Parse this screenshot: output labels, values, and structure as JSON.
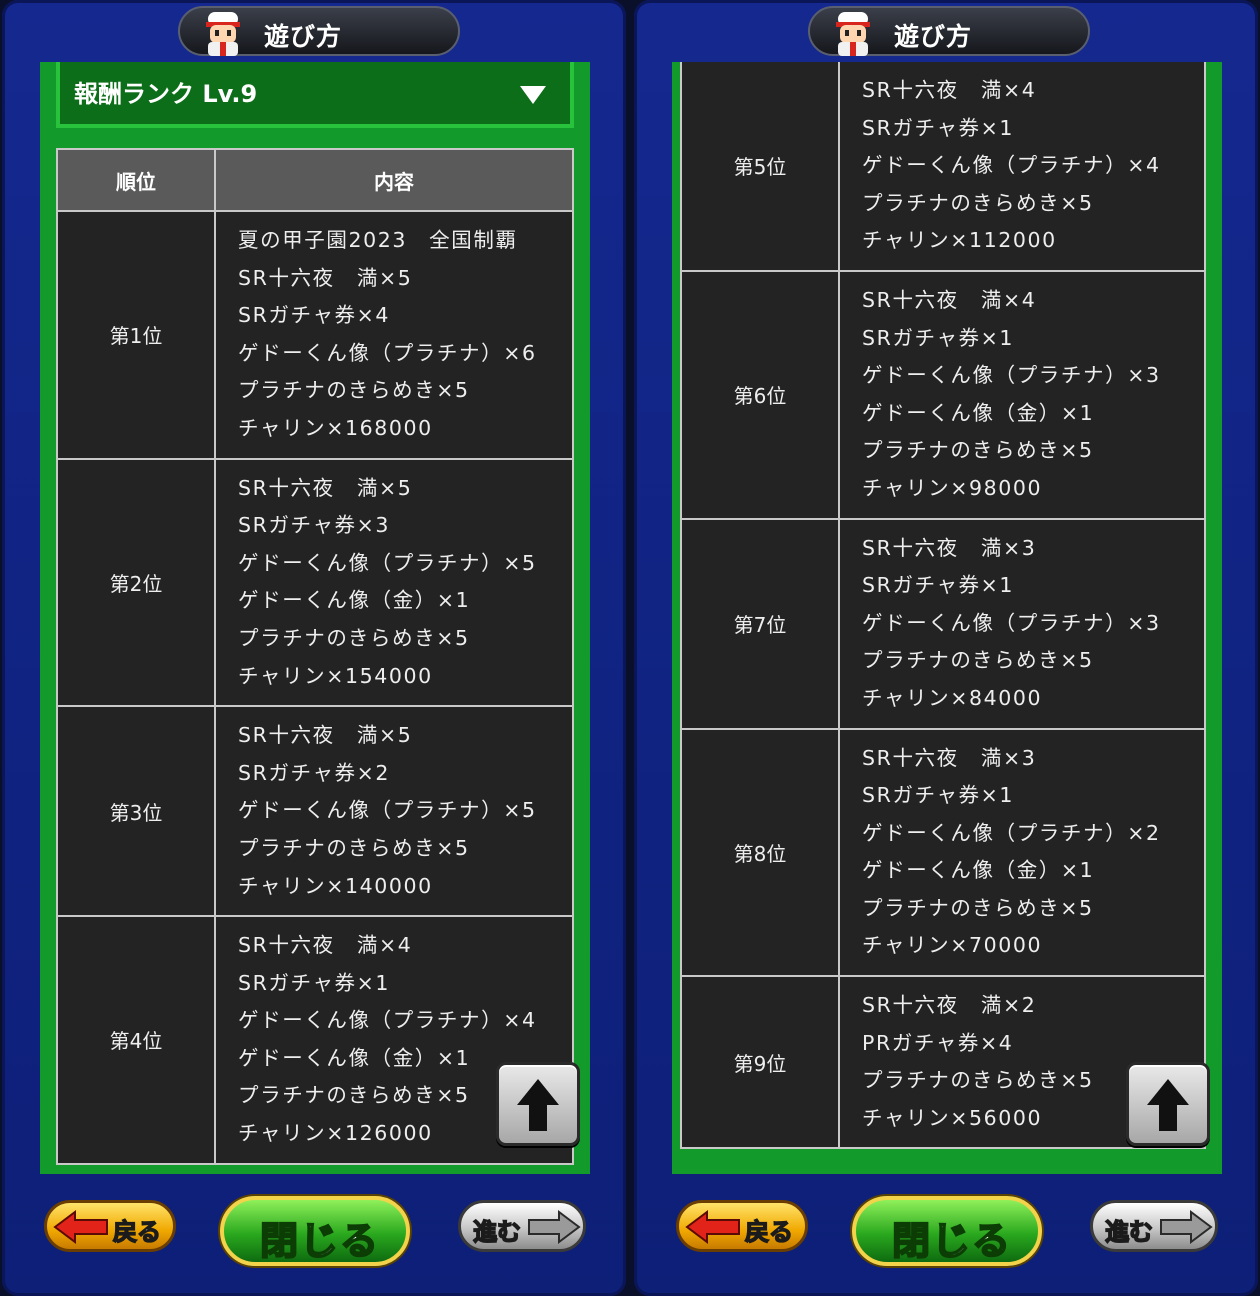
{
  "header": {
    "title": "遊び方"
  },
  "dropdown": {
    "label": "報酬ランク Lv.9"
  },
  "table": {
    "col_rank": "順位",
    "col_content": "内容"
  },
  "footer": {
    "back_label": "戻る",
    "close_label": "閉じる",
    "next_label": "進む"
  },
  "left": {
    "rows": [
      {
        "rank": "第1位",
        "items": [
          "夏の甲子園2023　全国制覇",
          "SR十六夜　満×5",
          "SRガチャ券×4",
          "ゲドーくん像（プラチナ）×6",
          "プラチナのきらめき×5",
          "チャリン×168000"
        ]
      },
      {
        "rank": "第2位",
        "items": [
          "SR十六夜　満×5",
          "SRガチャ券×3",
          "ゲドーくん像（プラチナ）×5",
          "ゲドーくん像（金）×1",
          "プラチナのきらめき×5",
          "チャリン×154000"
        ]
      },
      {
        "rank": "第3位",
        "items": [
          "SR十六夜　満×5",
          "SRガチャ券×2",
          "ゲドーくん像（プラチナ）×5",
          "プラチナのきらめき×5",
          "チャリン×140000"
        ]
      },
      {
        "rank": "第4位",
        "items": [
          "SR十六夜　満×4",
          "SRガチャ券×1",
          "ゲドーくん像（プラチナ）×4",
          "ゲドーくん像（金）×1",
          "プラチナのきらめき×5",
          "チャリン×126000"
        ]
      }
    ]
  },
  "right": {
    "rows": [
      {
        "rank": "第5位",
        "items": [
          "SR十六夜　満×4",
          "SRガチャ券×1",
          "ゲドーくん像（プラチナ）×4",
          "プラチナのきらめき×5",
          "チャリン×112000"
        ]
      },
      {
        "rank": "第6位",
        "items": [
          "SR十六夜　満×4",
          "SRガチャ券×1",
          "ゲドーくん像（プラチナ）×3",
          "ゲドーくん像（金）×1",
          "プラチナのきらめき×5",
          "チャリン×98000"
        ]
      },
      {
        "rank": "第7位",
        "items": [
          "SR十六夜　満×3",
          "SRガチャ券×1",
          "ゲドーくん像（プラチナ）×3",
          "プラチナのきらめき×5",
          "チャリン×84000"
        ]
      },
      {
        "rank": "第8位",
        "items": [
          "SR十六夜　満×3",
          "SRガチャ券×1",
          "ゲドーくん像（プラチナ）×2",
          "ゲドーくん像（金）×1",
          "プラチナのきらめき×5",
          "チャリン×70000"
        ]
      },
      {
        "rank": "第9位",
        "items": [
          "SR十六夜　満×2",
          "PRガチャ券×4",
          "プラチナのきらめき×5",
          "チャリン×56000"
        ]
      }
    ]
  },
  "colors": {
    "panel_blue": "#14288f",
    "green_frame": "#129a2a",
    "table_bg": "#232323",
    "header_cell": "#5a5a5a"
  },
  "icons": [
    "mascot-icon",
    "dropdown-arrow-icon",
    "up-arrow-icon",
    "left-arrow-icon",
    "right-arrow-icon"
  ]
}
